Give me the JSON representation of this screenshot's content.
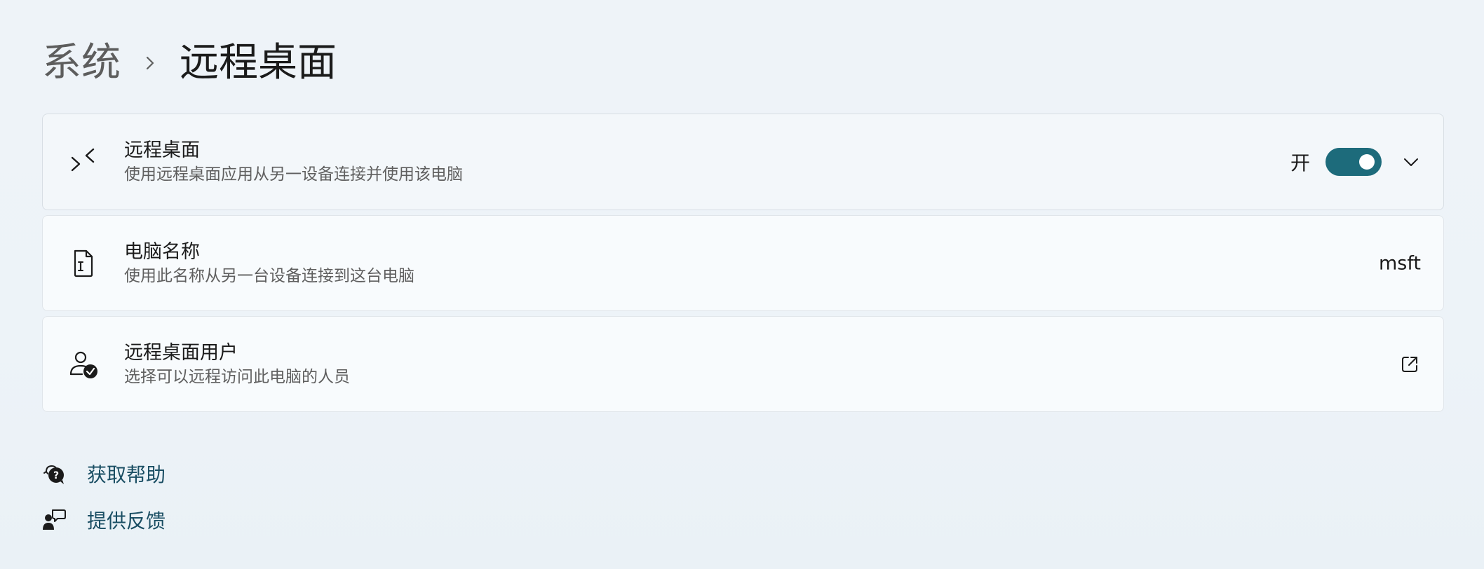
{
  "breadcrumb": {
    "parent": "系统",
    "separator_icon": "chevron-right-icon",
    "current": "远程桌面"
  },
  "cards": {
    "remote_desktop": {
      "icon": "remote-desktop-icon",
      "title": "远程桌面",
      "subtitle": "使用远程桌面应用从另一设备连接并使用该电脑",
      "toggle_label": "开",
      "toggle_on": true,
      "expand_icon": "chevron-down-icon"
    },
    "pc_name": {
      "icon": "pc-name-document-icon",
      "title": "电脑名称",
      "subtitle": "使用此名称从另一台设备连接到这台电脑",
      "value": "msft"
    },
    "remote_users": {
      "icon": "user-check-icon",
      "title": "远程桌面用户",
      "subtitle": "选择可以远程访问此电脑的人员",
      "action_icon": "open-external-icon"
    }
  },
  "links": {
    "help": {
      "icon": "help-chat-icon",
      "label": "获取帮助"
    },
    "feedback": {
      "icon": "feedback-person-icon",
      "label": "提供反馈"
    }
  },
  "colors": {
    "accent": "#1d6b7b",
    "link": "#1a4e63",
    "background": "#eef3f8"
  }
}
